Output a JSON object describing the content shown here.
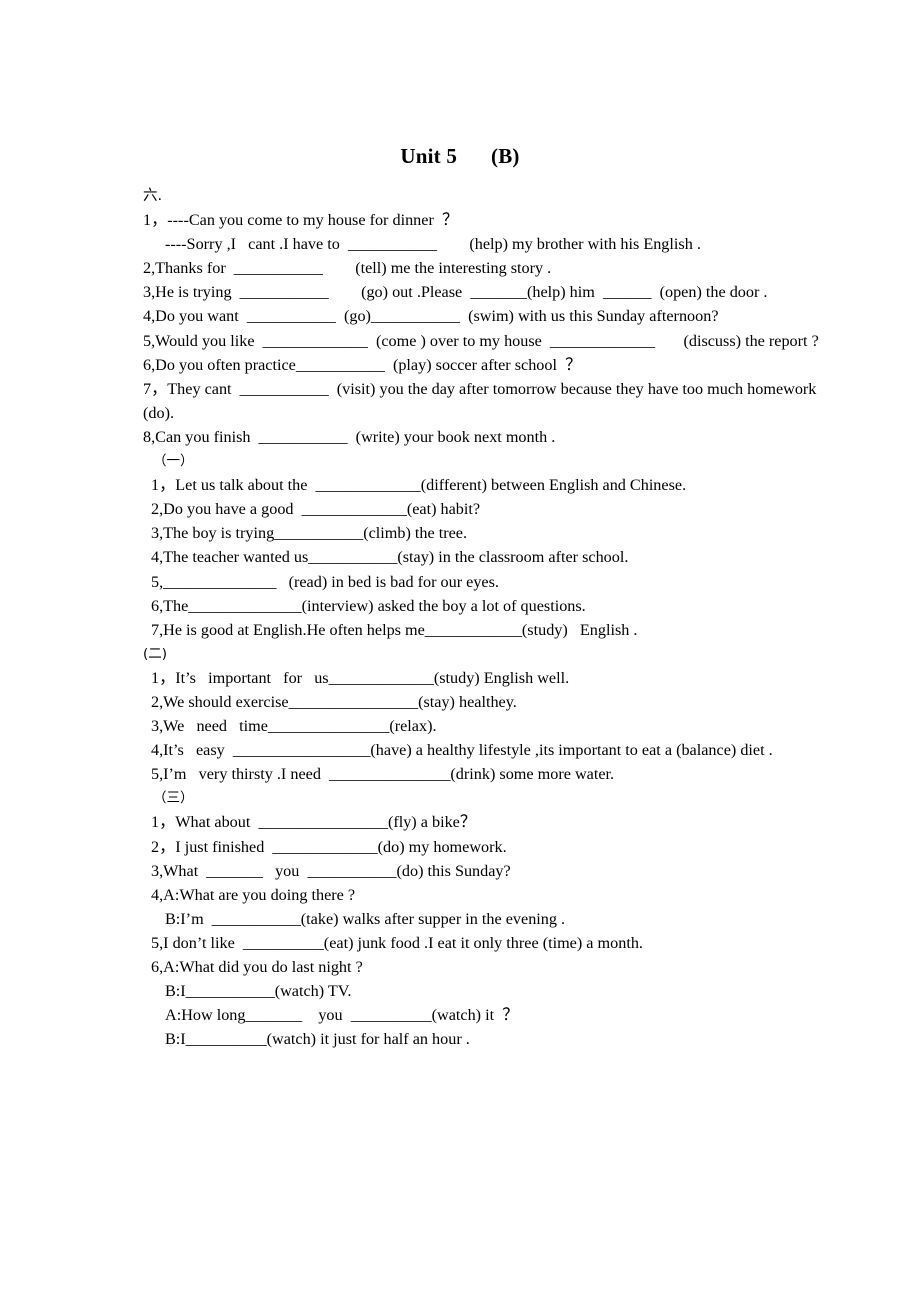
{
  "document": {
    "title_main": "Unit 5",
    "title_suffix": "(B)",
    "section_six_label": "六.",
    "section_one_label": "（一）",
    "section_two_label": "(二)",
    "section_three_label": "（三）",
    "part_six_lines": [
      "1，----Can you come to my house for dinner  ？",
      "----Sorry ,I   cant .I have to  ___________        (help) my brother with his English .",
      "2,Thanks for  ___________        (tell) me the interesting story .",
      "3,He is trying  ___________        (go) out .Please  _______(help) him  ______  (open) the door .",
      "4,Do you want  ___________  (go)___________  (swim) with us this Sunday afternoon?",
      "5,Would you like  _____________  (come ) over to my house  _____________       (discuss) the report ?",
      "6,Do you often practice___________  (play) soccer after school  ？",
      "7，They cant  ___________  (visit) you the day after tomorrow because they have too much homework (do).",
      "8,Can you finish  ___________  (write) your book next month ."
    ],
    "part_one_lines": [
      "1，Let us talk about the  _____________(different) between English and Chinese.",
      "2,Do you have a good  _____________(eat) habit?",
      "3,The boy is trying___________(climb) the tree.",
      "4,The teacher wanted us___________(stay) in the classroom after school.",
      "5,______________   (read) in bed is bad for our eyes.",
      "6,The______________(interview) asked the boy a lot of questions.",
      "7,He is good at English.He often helps me____________(study)   English ."
    ],
    "part_two_lines": [
      "1，It’s   important   for   us_____________(study) English well.",
      "2,We should exercise________________(stay) healthey.",
      "3,We   need   time_______________(relax).",
      "4,It’s   easy  _________________(have) a healthy lifestyle ,its important to eat a (balance) diet .",
      "5,I’m   very thirsty .I need  _______________(drink) some more water."
    ],
    "part_three_lines": [
      "1，What about  ________________(fly) a bike？",
      "2，I just finished  _____________(do) my homework.",
      "3,What  _______   you  ___________(do) this Sunday?",
      "4,A:What are you doing there ?",
      "B:I’m  ___________(take) walks after supper in the evening .",
      "5,I don’t like  __________(eat) junk food .I eat it only three (time) a month.",
      "6,A:What did you do last night ?",
      "B:I___________(watch) TV.",
      "A:How long_______    you  __________(watch) it  ？",
      "B:I__________(watch) it just for half an hour ."
    ]
  }
}
